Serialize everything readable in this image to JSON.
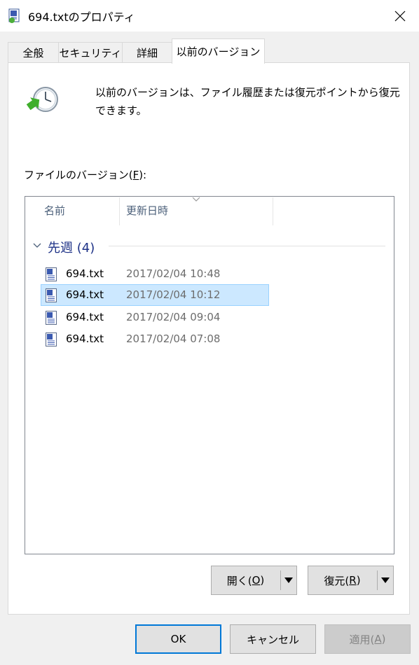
{
  "window": {
    "title": "694.txtのプロパティ",
    "close_glyph": "✕"
  },
  "tabs": [
    {
      "label": "全般",
      "active": false
    },
    {
      "label": "セキュリティ",
      "active": false
    },
    {
      "label": "詳細",
      "active": false
    },
    {
      "label": "以前のバージョン",
      "active": true
    }
  ],
  "description": "以前のバージョンは、ファイル履歴または復元ポイントから復元できます。",
  "versions_label": {
    "prefix": "ファイルのバージョン(",
    "accel": "F",
    "suffix": "):"
  },
  "list": {
    "columns": [
      "名前",
      "更新日時"
    ],
    "group": {
      "title": "先週 (4)"
    },
    "rows": [
      {
        "name": "694.txt",
        "date": "2017/02/04 10:48",
        "selected": false
      },
      {
        "name": "694.txt",
        "date": "2017/02/04 10:12",
        "selected": true
      },
      {
        "name": "694.txt",
        "date": "2017/02/04 09:04",
        "selected": false
      },
      {
        "name": "694.txt",
        "date": "2017/02/04 07:08",
        "selected": false
      }
    ]
  },
  "actions": {
    "open": {
      "prefix": "開く(",
      "accel": "O",
      "suffix": ")"
    },
    "restore": {
      "prefix": "復元(",
      "accel": "R",
      "suffix": ")"
    }
  },
  "footer": {
    "ok": "OK",
    "cancel": "キャンセル",
    "apply": {
      "prefix": "適用(",
      "accel": "A",
      "suffix": ")",
      "enabled": false
    }
  },
  "colors": {
    "accent": "#0078d7",
    "selection": "#cce8ff",
    "group_title": "#1e3287"
  },
  "icons": {
    "title": "text-file-icon",
    "restore": "previous-versions-clock-icon",
    "file": "text-file-icon"
  }
}
